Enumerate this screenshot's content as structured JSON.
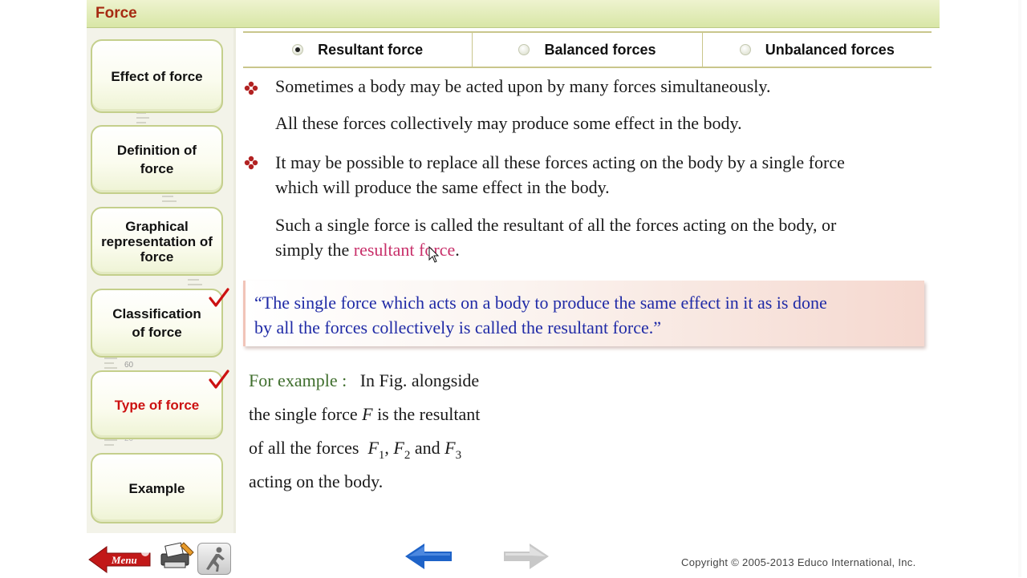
{
  "app": {
    "title": "Force"
  },
  "sidebar": {
    "items": [
      {
        "label": "Effect of force",
        "active": false,
        "checked": false
      },
      {
        "label": "Definition of force",
        "active": false,
        "checked": false
      },
      {
        "label": "Graphical representation of force",
        "active": false,
        "checked": false
      },
      {
        "label": "Classification of force",
        "active": false,
        "checked": true
      },
      {
        "label": "Type of force",
        "active": true,
        "checked": true
      },
      {
        "label": "Example",
        "active": false,
        "checked": false
      }
    ],
    "ruler_marks": [
      "60",
      "20"
    ]
  },
  "tabs": [
    {
      "label": "Resultant force",
      "selected": true
    },
    {
      "label": "Balanced forces",
      "selected": false
    },
    {
      "label": "Unbalanced forces",
      "selected": false
    }
  ],
  "content": {
    "p1": "Sometimes a body may be acted upon by many forces simultaneously.",
    "p2": "All these forces collectively may produce some effect in the body.",
    "p3_line1": "It may be possible to replace all these forces acting on the body by a single force",
    "p3_line2": "which will produce the same effect in the body.",
    "p4_line1": "Such a single force is called the resultant of all the forces acting on the body, or",
    "p4_line2_prefix": "simply the",
    "p4_highlight": "resultant force",
    "p4_suffix": ".",
    "quote_line1": "“The single force which acts on a body to produce the same effect in it as is done",
    "quote_line2": "by all the forces collectively is called the resultant force.”"
  },
  "example": {
    "label": "For example :",
    "line1_rest": "In Fig. alongside",
    "line2_pre": "the single force",
    "line2_var": "F",
    "line2_post": "is the resultant",
    "line3_pre": "of all the forces",
    "f": "F",
    "sub1": "1",
    "sub2": "2",
    "sub3": "3",
    "and": "and",
    "line4": "acting on the body."
  },
  "footer": {
    "menu_label": "Menu",
    "copyright": "Copyright © 2005-2013 Educo International, Inc."
  },
  "colors": {
    "title": "#a62a12",
    "highlight": "#c8306a",
    "quote": "#1f2aa6",
    "example_label": "#3f6e2d",
    "check": "#cc1111",
    "back_arrow": "#1e63c8",
    "forward_arrow_disabled": "#c8c8c8"
  }
}
